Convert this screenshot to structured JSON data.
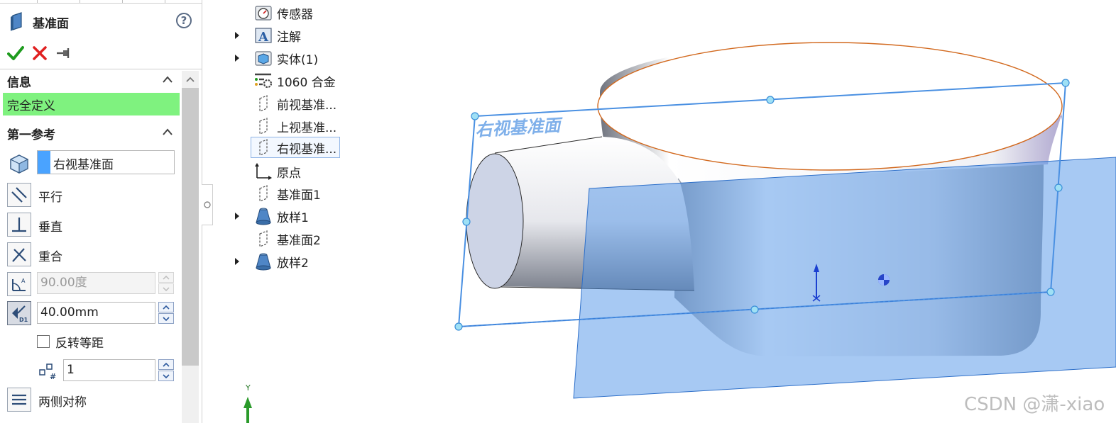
{
  "property_manager": {
    "title": "基准面",
    "help_glyph": "?",
    "actions": [
      {
        "name": "ok-button",
        "icon": "check-icon",
        "color": "#1e9b1e"
      },
      {
        "name": "cancel-button",
        "icon": "close-icon",
        "color": "#e02020"
      },
      {
        "name": "pin-button",
        "icon": "pushpin-icon",
        "color": "#555555"
      }
    ],
    "info": {
      "header": "信息",
      "status": "完全定义",
      "status_color": "#7ff27f"
    },
    "first_reference": {
      "header": "第一参考",
      "selected_reference": "右视基准面",
      "options": {
        "parallel": "平行",
        "perpendicular": "垂直",
        "coincident": "重合"
      },
      "angle_value": "90.00度",
      "distance_value": "40.00mm",
      "flip_offset_label": "反转等距",
      "flip_offset_checked": false,
      "instance_count": "1",
      "mid_plane_label": "两侧对称"
    }
  },
  "feature_tree": {
    "items": [
      {
        "label": "传感器",
        "icon": "sensor-icon",
        "expandable": false
      },
      {
        "label": "注解",
        "icon": "annotation-icon",
        "expandable": true
      },
      {
        "label": "实体(1)",
        "icon": "solid-body-icon",
        "expandable": true
      },
      {
        "label": "1060 合金",
        "icon": "material-icon",
        "expandable": false
      },
      {
        "label": "前视基准...",
        "icon": "plane-icon",
        "expandable": false
      },
      {
        "label": "上视基准...",
        "icon": "plane-icon",
        "expandable": false
      },
      {
        "label": "右视基准...",
        "icon": "plane-icon",
        "expandable": false,
        "selected": true
      },
      {
        "label": "原点",
        "icon": "origin-icon",
        "expandable": false
      },
      {
        "label": "基准面1",
        "icon": "plane-icon",
        "expandable": false
      },
      {
        "label": "放样1",
        "icon": "loft-icon",
        "expandable": true
      },
      {
        "label": "基准面2",
        "icon": "plane-icon",
        "expandable": false
      },
      {
        "label": "放样2",
        "icon": "loft-icon",
        "expandable": true
      }
    ]
  },
  "viewport": {
    "plane_label": "右视基准面",
    "triad_axis_label": "Y",
    "plane_color": "#4f93e8",
    "edge_highlight_color": "#d2691e"
  },
  "watermark": "CSDN @潇-xiao"
}
